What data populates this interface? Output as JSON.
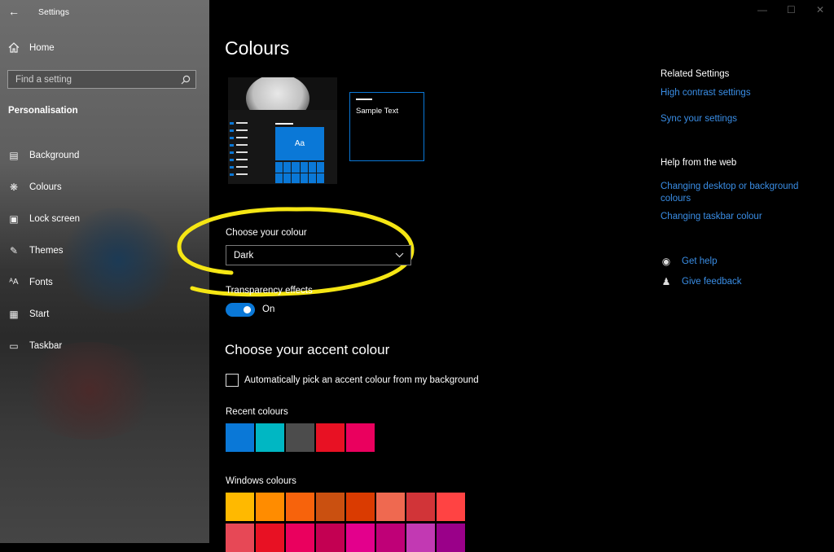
{
  "window": {
    "title": "Settings",
    "back_icon": "back-arrow-icon"
  },
  "sidebar": {
    "home_label": "Home",
    "search_placeholder": "Find a setting",
    "section": "Personalisation",
    "items": [
      {
        "label": "Background",
        "icon": "picture-icon"
      },
      {
        "label": "Colours",
        "icon": "palette-icon"
      },
      {
        "label": "Lock screen",
        "icon": "lock-screen-icon"
      },
      {
        "label": "Themes",
        "icon": "brush-icon"
      },
      {
        "label": "Fonts",
        "icon": "font-icon"
      },
      {
        "label": "Start",
        "icon": "start-menu-icon"
      },
      {
        "label": "Taskbar",
        "icon": "taskbar-icon"
      }
    ]
  },
  "main": {
    "title": "Colours",
    "preview": {
      "tile_text": "Aa",
      "sample_text": "Sample Text"
    },
    "choose_colour": {
      "label": "Choose your colour",
      "value": "Dark"
    },
    "transparency": {
      "label": "Transparency effects",
      "state": "On",
      "enabled": true
    },
    "accent": {
      "heading": "Choose your accent colour",
      "auto_pick_label": "Automatically pick an accent colour from my background",
      "auto_pick_checked": false,
      "recent_label": "Recent colours",
      "recent_colours": [
        "#0a78d7",
        "#00b7c3",
        "#4c4c4c",
        "#e81123",
        "#ea005e"
      ],
      "windows_label": "Windows colours",
      "windows_colours_row1": [
        "#ffb900",
        "#ff8c00",
        "#f7630c",
        "#ca5010",
        "#da3b01",
        "#ef6950",
        "#d13438",
        "#ff4343"
      ],
      "windows_colours_row2": [
        "#e74856",
        "#e81123",
        "#ea005e",
        "#c30052",
        "#e3008c",
        "#bf0077",
        "#c239b3",
        "#9a0089"
      ]
    }
  },
  "right": {
    "related_heading": "Related Settings",
    "related_links": [
      "High contrast settings",
      "Sync your settings"
    ],
    "help_heading": "Help from the web",
    "help_link_1": "Changing desktop or background colours",
    "help_link_2": "Changing taskbar colour",
    "get_help": "Get help",
    "give_feedback": "Give feedback"
  },
  "colors": {
    "accent": "#0a78d7",
    "highlight_marker": "#f5e614",
    "link": "#3a8ee6"
  }
}
